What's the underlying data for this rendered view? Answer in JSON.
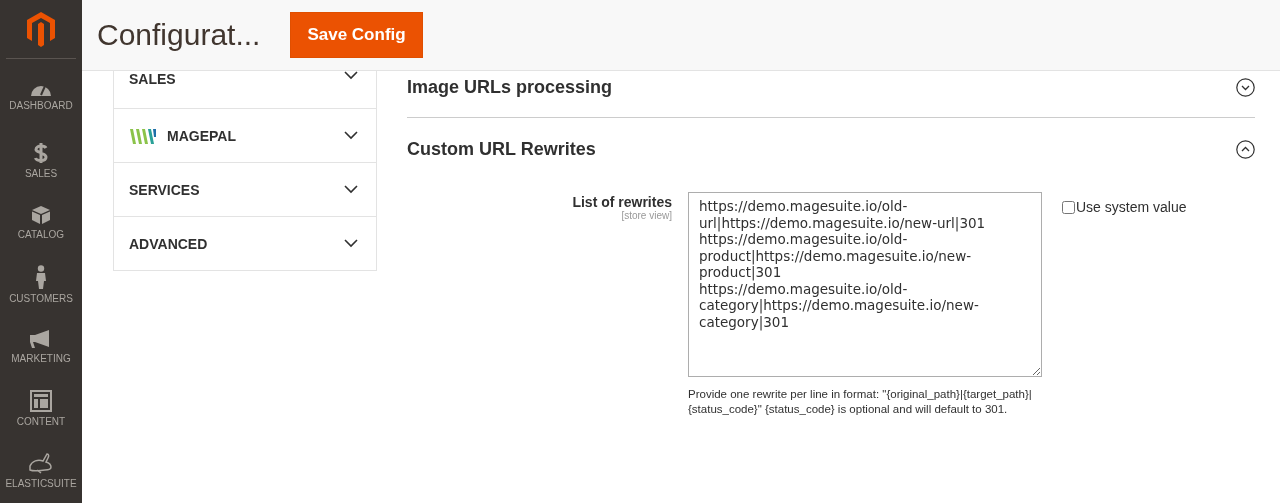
{
  "nav": [
    {
      "label": "DASHBOARD",
      "selected": false
    },
    {
      "label": "SALES",
      "selected": false
    },
    {
      "label": "CATALOG",
      "selected": false
    },
    {
      "label": "CUSTOMERS",
      "selected": false
    },
    {
      "label": "MARKETING",
      "selected": false
    },
    {
      "label": "CONTENT",
      "selected": false
    },
    {
      "label": "ELASTICSUITE",
      "selected": false
    }
  ],
  "header": {
    "title": "Configurat...",
    "save_button": "Save Config"
  },
  "config_tabs": [
    {
      "label": "SALES",
      "kind": "plain",
      "expanded": false
    },
    {
      "label": "MAGEPAL",
      "kind": "logo",
      "expanded": false
    },
    {
      "label": "SERVICES",
      "kind": "plain",
      "expanded": false
    },
    {
      "label": "ADVANCED",
      "kind": "plain",
      "expanded": false
    }
  ],
  "sections": [
    {
      "title": "Image URLs processing",
      "expanded": false
    },
    {
      "title": "Custom URL Rewrites",
      "expanded": true
    }
  ],
  "field": {
    "label": "List of rewrites",
    "scope": "[store view]",
    "value": "https://demo.magesuite.io/old-url|https://demo.magesuite.io/new-url|301\nhttps://demo.magesuite.io/old-product|https://demo.magesuite.io/new-product|301\nhttps://demo.magesuite.io/old-category|https://demo.magesuite.io/new-category|301",
    "use_system_value": {
      "label": "Use system value",
      "checked": false
    },
    "note": "Provide one rewrite per line in format: \"{original_path}|{target_path}|{status_code}\" {status_code} is optional and will default to 301."
  }
}
